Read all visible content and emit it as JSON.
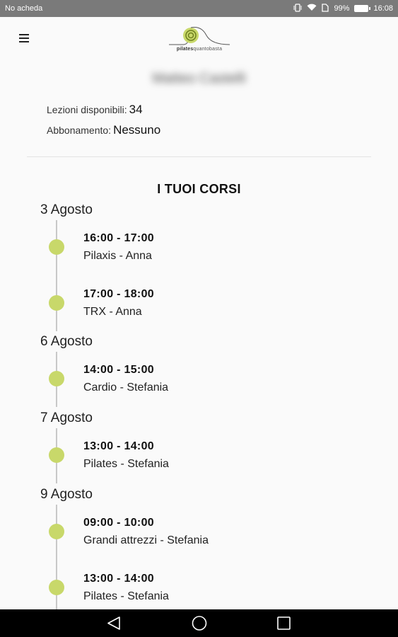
{
  "status_bar": {
    "carrier": "No acheda",
    "battery_percent": "99%",
    "time": "16:08",
    "icons": [
      "vibrate-icon",
      "wifi-icon",
      "sim-icon",
      "battery-icon"
    ]
  },
  "app_bar": {
    "menu_icon": "hamburger-menu-icon",
    "logo_text_bold": "pilates",
    "logo_text_light": "quantobasta"
  },
  "profile": {
    "name": "Matteo Castelli",
    "lessons_label": "Lezioni disponibili:",
    "lessons_value": "34",
    "subscription_label": "Abbonamento:",
    "subscription_value": "Nessuno"
  },
  "courses": {
    "title": "I TUOI CORSI",
    "dot_color": "#c8d86a",
    "days": [
      {
        "date": "3 Agosto",
        "items": [
          {
            "time": "16:00 - 17:00",
            "course": "Pilaxis - Anna"
          },
          {
            "time": "17:00 - 18:00",
            "course": "TRX - Anna"
          }
        ]
      },
      {
        "date": "6 Agosto",
        "items": [
          {
            "time": "14:00 - 15:00",
            "course": "Cardio - Stefania"
          }
        ]
      },
      {
        "date": "7 Agosto",
        "items": [
          {
            "time": "13:00 - 14:00",
            "course": "Pilates - Stefania"
          }
        ]
      },
      {
        "date": "9 Agosto",
        "items": [
          {
            "time": "09:00 - 10:00",
            "course": "Grandi attrezzi - Stefania"
          },
          {
            "time": "13:00 - 14:00",
            "course": "Pilates - Stefania"
          }
        ]
      }
    ]
  },
  "nav_bar": {
    "buttons": [
      "back-icon",
      "home-icon",
      "recents-icon"
    ]
  }
}
